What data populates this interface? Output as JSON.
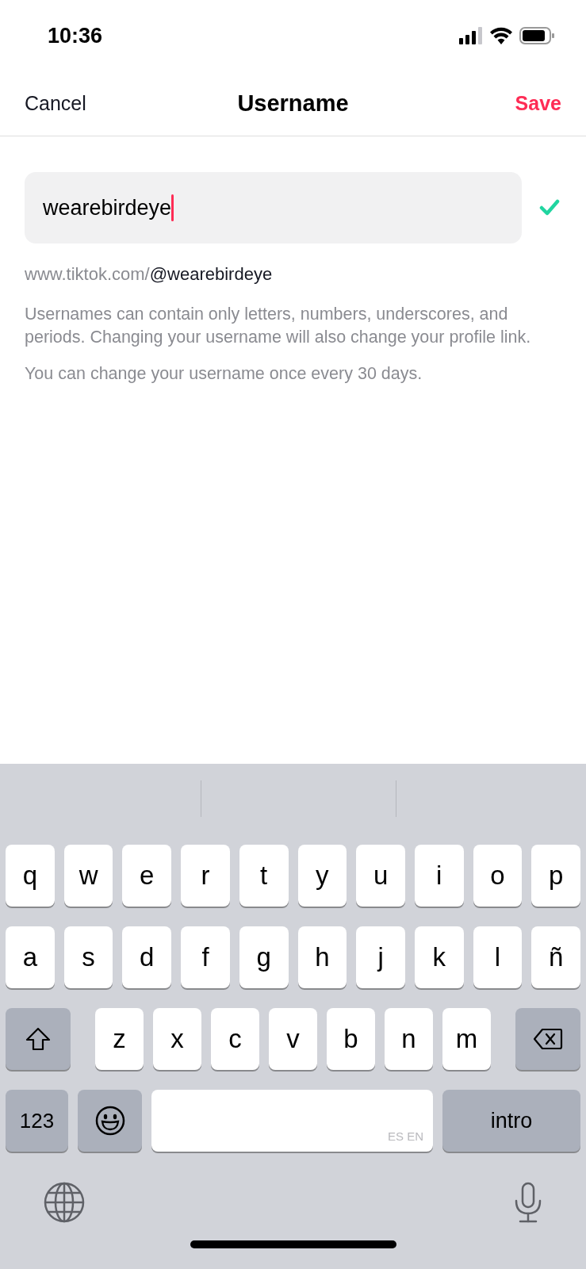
{
  "status_bar": {
    "time": "10:36"
  },
  "nav": {
    "cancel": "Cancel",
    "title": "Username",
    "save": "Save"
  },
  "username_field": {
    "value": "wearebirdeye",
    "focused": true,
    "valid": true
  },
  "profile_link": {
    "prefix": "www.tiktok.com/",
    "handle": "@wearebirdeye"
  },
  "help_text": "Usernames can contain only letters, numbers, underscores, and periods. Changing your username will also change your profile link.",
  "limit_note": "You can change your username once every 30 days.",
  "keyboard": {
    "rows": [
      [
        {
          "kind": "letter",
          "label": "q"
        },
        {
          "kind": "letter",
          "label": "w"
        },
        {
          "kind": "letter",
          "label": "e"
        },
        {
          "kind": "letter",
          "label": "r"
        },
        {
          "kind": "letter",
          "label": "t"
        },
        {
          "kind": "letter",
          "label": "y"
        },
        {
          "kind": "letter",
          "label": "u"
        },
        {
          "kind": "letter",
          "label": "i"
        },
        {
          "kind": "letter",
          "label": "o"
        },
        {
          "kind": "letter",
          "label": "p"
        }
      ],
      [
        {
          "kind": "letter",
          "label": "a"
        },
        {
          "kind": "letter",
          "label": "s"
        },
        {
          "kind": "letter",
          "label": "d"
        },
        {
          "kind": "letter",
          "label": "f"
        },
        {
          "kind": "letter",
          "label": "g"
        },
        {
          "kind": "letter",
          "label": "h"
        },
        {
          "kind": "letter",
          "label": "j"
        },
        {
          "kind": "letter",
          "label": "k"
        },
        {
          "kind": "letter",
          "label": "l"
        },
        {
          "kind": "letter",
          "label": "ñ"
        }
      ],
      [
        {
          "kind": "shift"
        },
        {
          "kind": "letter",
          "label": "z"
        },
        {
          "kind": "letter",
          "label": "x"
        },
        {
          "kind": "letter",
          "label": "c"
        },
        {
          "kind": "letter",
          "label": "v"
        },
        {
          "kind": "letter",
          "label": "b"
        },
        {
          "kind": "letter",
          "label": "n"
        },
        {
          "kind": "letter",
          "label": "m"
        },
        {
          "kind": "delete"
        }
      ]
    ],
    "bottom_keys": [
      {
        "kind": "numbers",
        "label": "123"
      },
      {
        "kind": "emoji"
      },
      {
        "kind": "space",
        "label": "ES EN"
      },
      {
        "kind": "return",
        "label": "intro"
      }
    ]
  }
}
